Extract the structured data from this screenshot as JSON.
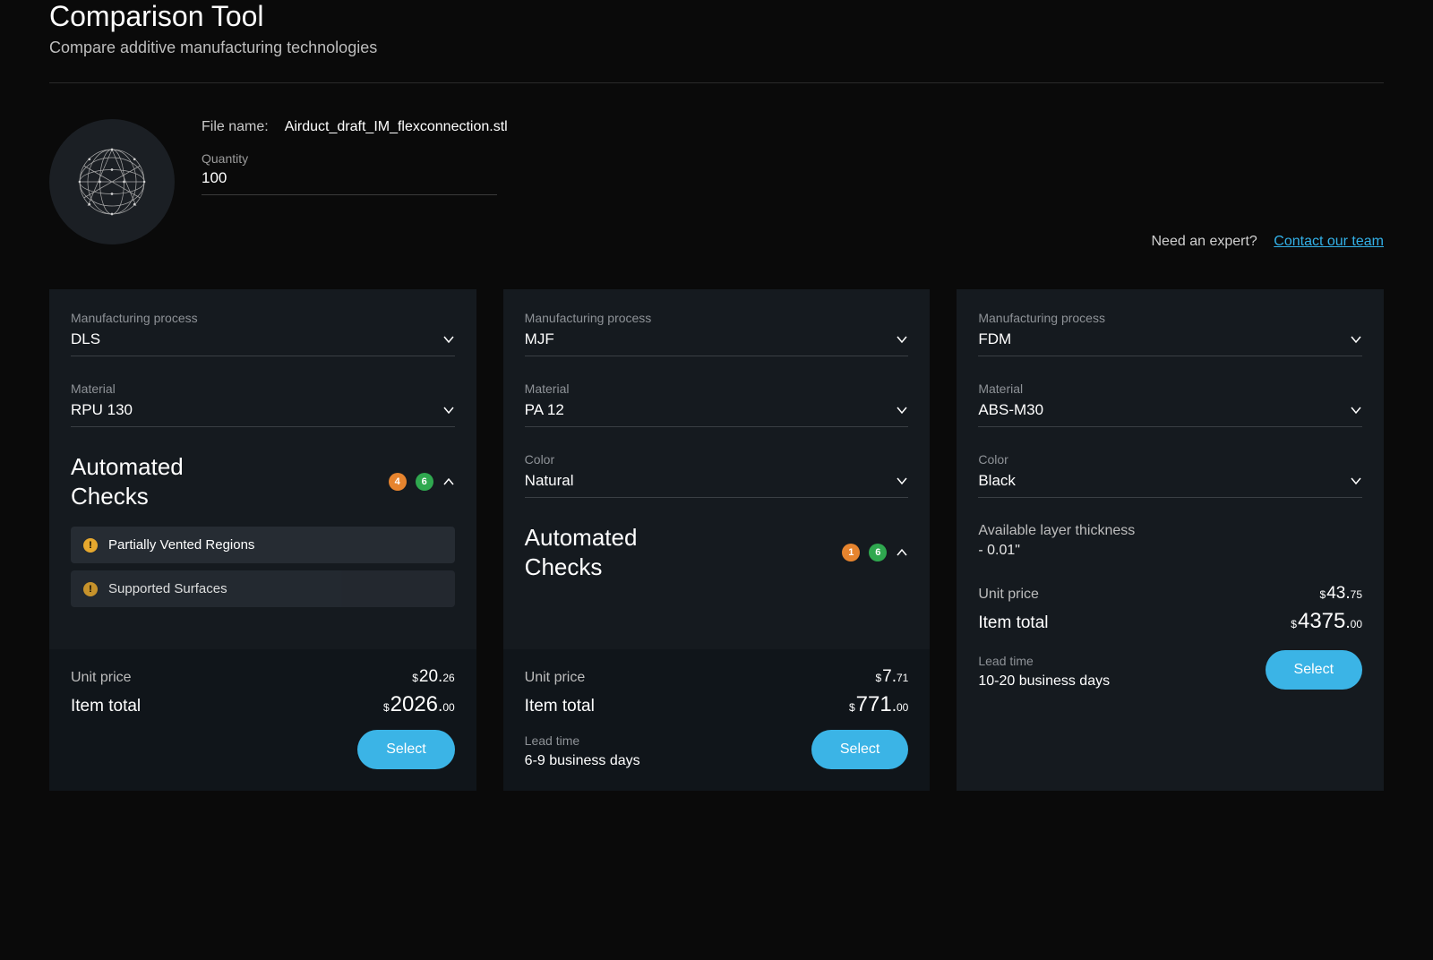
{
  "header": {
    "title": "Comparison Tool",
    "subtitle": "Compare additive manufacturing technologies"
  },
  "file": {
    "label": "File name:",
    "name": "Airduct_draft_IM_flexconnection.stl",
    "qty_label": "Quantity",
    "qty_value": "100"
  },
  "expert": {
    "text": "Need an expert?",
    "link": "Contact our team"
  },
  "labels": {
    "process": "Manufacturing process",
    "material": "Material",
    "color": "Color",
    "checks": "Automated Checks",
    "unit_price": "Unit price",
    "item_total": "Item total",
    "lead_time": "Lead time",
    "select": "Select",
    "layer_label": "Available layer thickness"
  },
  "cards": [
    {
      "process": "DLS",
      "material": "RPU 130",
      "warn": "4",
      "ok": "6",
      "checks": [
        "Partially Vented Regions",
        "Supported Surfaces"
      ],
      "unit_whole": "20",
      "unit_cents": "26",
      "total_whole": "2026",
      "total_cents": "00"
    },
    {
      "process": "MJF",
      "material": "PA 12",
      "color": "Natural",
      "warn": "1",
      "ok": "6",
      "unit_whole": "7",
      "unit_cents": "71",
      "total_whole": "771",
      "total_cents": "00",
      "lead": "6-9 business days"
    },
    {
      "process": "FDM",
      "material": "ABS-M30",
      "color": "Black",
      "layer_value": "- 0.01\"",
      "unit_whole": "43",
      "unit_cents": "75",
      "total_whole": "4375",
      "total_cents": "00",
      "lead": "10-20 business days"
    }
  ]
}
